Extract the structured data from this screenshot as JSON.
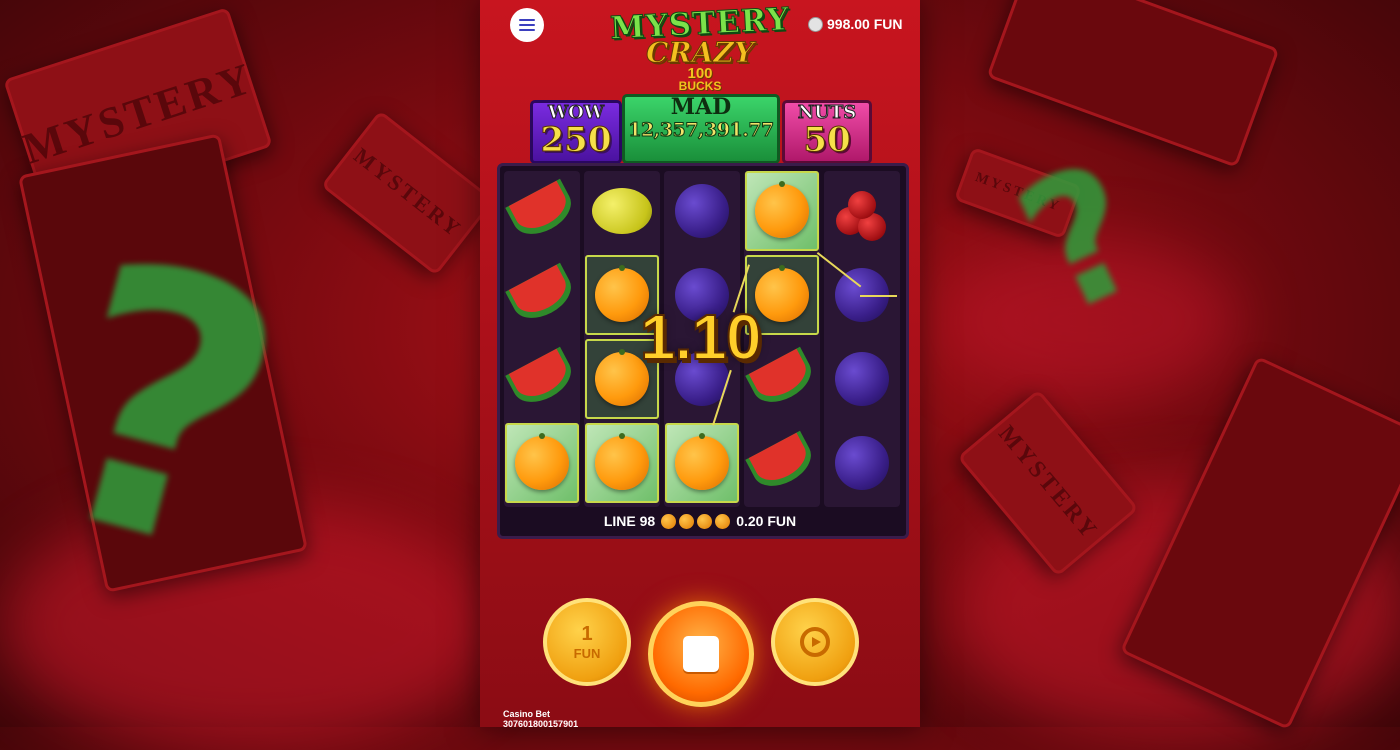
{
  "header": {
    "menu_icon": "hamburger-menu-icon",
    "balance": "998.00 FUN"
  },
  "logo": {
    "line1": "MYSTERY",
    "line2": "CRAZY",
    "line3": "100",
    "line4": "BUCKS"
  },
  "jackpots": [
    {
      "name": "WOW",
      "value": "250"
    },
    {
      "name": "MAD",
      "value": "12,357,391.77"
    },
    {
      "name": "NUTS",
      "value": "50"
    }
  ],
  "background": {
    "bill_text": "MYSTERY"
  },
  "reels": [
    [
      "watermelon",
      "watermelon",
      "watermelon",
      "orange-cash"
    ],
    [
      "lemon",
      "orange",
      "orange",
      "orange-cash"
    ],
    [
      "plum",
      "plum",
      "plum",
      "orange-cash"
    ],
    [
      "orange-cash",
      "orange",
      "watermelon",
      "watermelon"
    ],
    [
      "cherry",
      "plum",
      "plum",
      "plum"
    ]
  ],
  "win_amount": "1.10",
  "line_info": {
    "line_label": "LINE 98",
    "symbol_count": 4,
    "win": "0.20 FUN"
  },
  "controls": {
    "bet_value": "1",
    "bet_unit": "FUN"
  },
  "footer": {
    "label": "Casino Bet",
    "id": "307601800157901"
  }
}
